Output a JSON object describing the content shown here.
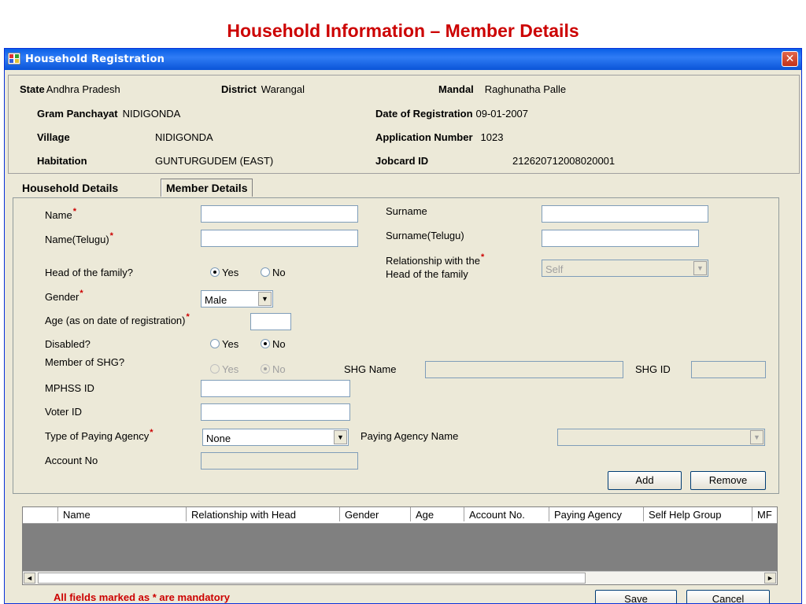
{
  "slide_title": "Household Information – Member Details",
  "window": {
    "title": "Household Registration",
    "close_symbol": "✕"
  },
  "header": {
    "state_label": "State",
    "state_value": "Andhra Pradesh",
    "district_label": "District",
    "district_value": "Warangal",
    "mandal_label": "Mandal",
    "mandal_value": "Raghunatha Palle",
    "gram_panchayat_label": "Gram Panchayat",
    "gram_panchayat_value": "NIDIGONDA",
    "date_label": "Date of Registration",
    "date_value": "09-01-2007",
    "village_label": "Village",
    "village_value": "NIDIGONDA",
    "app_no_label": "Application Number",
    "app_no_value": "1023",
    "habitation_label": "Habitation",
    "habitation_value": "GUNTURGUDEM (EAST)",
    "jobcard_label": "Jobcard ID",
    "jobcard_value": "212620712008020001"
  },
  "tabs": {
    "household": "Household Details",
    "member": "Member Details"
  },
  "form": {
    "name_label": "Name",
    "name_value": "",
    "surname_label": "Surname",
    "surname_value": "",
    "name_telugu_label": "Name(Telugu)",
    "name_telugu_value": "",
    "surname_telugu_label": "Surname(Telugu)",
    "surname_telugu_value": "",
    "head_label": "Head of the family?",
    "yes_label": "Yes",
    "no_label": "No",
    "relationship_label_1": "Relationship with the",
    "relationship_label_2": "Head of the family",
    "relationship_value": "Self",
    "gender_label": "Gender",
    "gender_value": "Male",
    "age_label": "Age  (as on date of registration)",
    "age_value": "",
    "disabled_label": "Disabled?",
    "shg_member_label": "Member of SHG?",
    "shg_name_label": "SHG Name",
    "shg_id_label": "SHG ID",
    "mphss_label": "MPHSS ID",
    "voter_label": "Voter ID",
    "paying_agency_type_label": "Type of Paying Agency",
    "paying_agency_type_value": "None",
    "paying_agency_name_label": "Paying Agency Name",
    "account_label": "Account No",
    "add_button": "Add",
    "remove_button": "Remove",
    "required_mark": "*"
  },
  "grid": {
    "columns": [
      "Name",
      "Relationship with Head",
      "Gender",
      "Age",
      "Account No.",
      "Paying Agency",
      "Self Help Group",
      "MF"
    ],
    "left_arrow": "◄",
    "right_arrow": "►"
  },
  "footer": {
    "note": "All fields marked as * are mandatory",
    "save_button": "Save",
    "cancel_button": "Cancel"
  },
  "colors": {
    "title_red": "#cc0000",
    "titlebar_blue": "#0a54d8",
    "window_bg": "#ece9d8",
    "grid_bg": "#808080"
  },
  "icons": {
    "app": "app-window-icon",
    "close": "close-icon",
    "dropdown": "dropdown-arrow-icon"
  }
}
